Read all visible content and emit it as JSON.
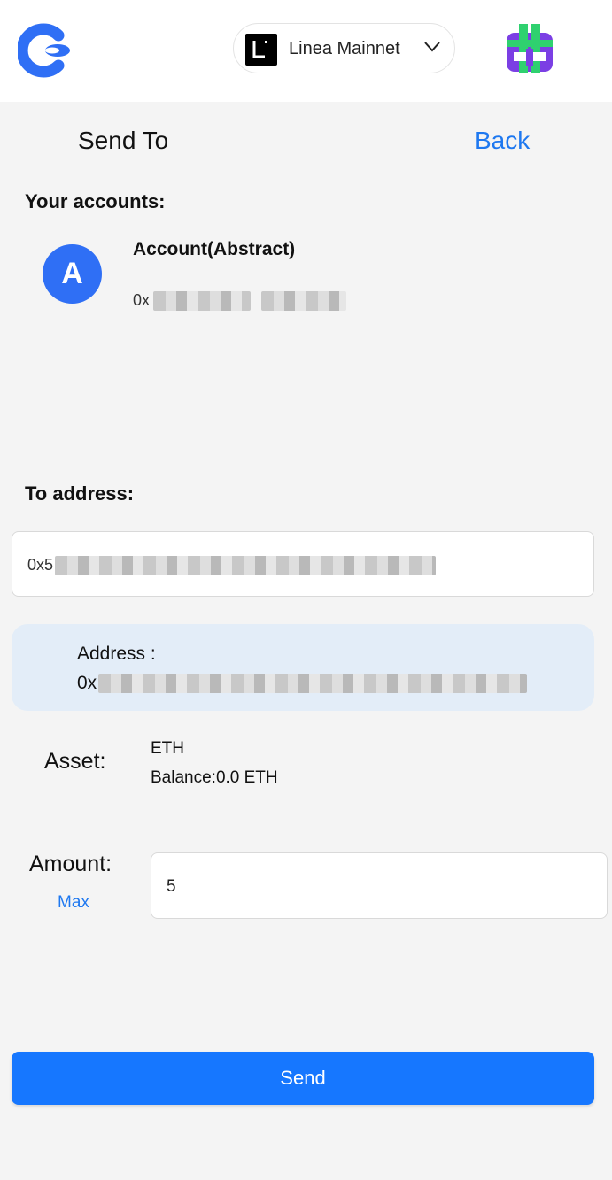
{
  "header": {
    "network_label": "Linea Mainnet",
    "network_icon": "linea-logo-icon",
    "app_logo": "app-logo-icon",
    "profile_badge": "profile-badge-icon"
  },
  "page": {
    "title": "Send To",
    "back_label": "Back"
  },
  "accounts": {
    "section_label": "Your accounts:",
    "items": [
      {
        "avatar_letter": "A",
        "name": "Account(Abstract)",
        "address_prefix": "0x"
      }
    ]
  },
  "to_address": {
    "section_label": "To address:",
    "input_value_prefix": "0x5"
  },
  "address_card": {
    "label": "Address :",
    "value_prefix": "0x"
  },
  "asset": {
    "label": "Asset:",
    "name": "ETH",
    "balance": "Balance:0.0 ETH"
  },
  "amount": {
    "label": "Amount:",
    "max_label": "Max",
    "value": "5"
  },
  "actions": {
    "send_label": "Send"
  },
  "colors": {
    "accent": "#1677ff",
    "link": "#1e78f0",
    "avatar": "#2f6ff5",
    "card_bg": "#e3edf8",
    "page_bg": "#f4f4f4"
  }
}
